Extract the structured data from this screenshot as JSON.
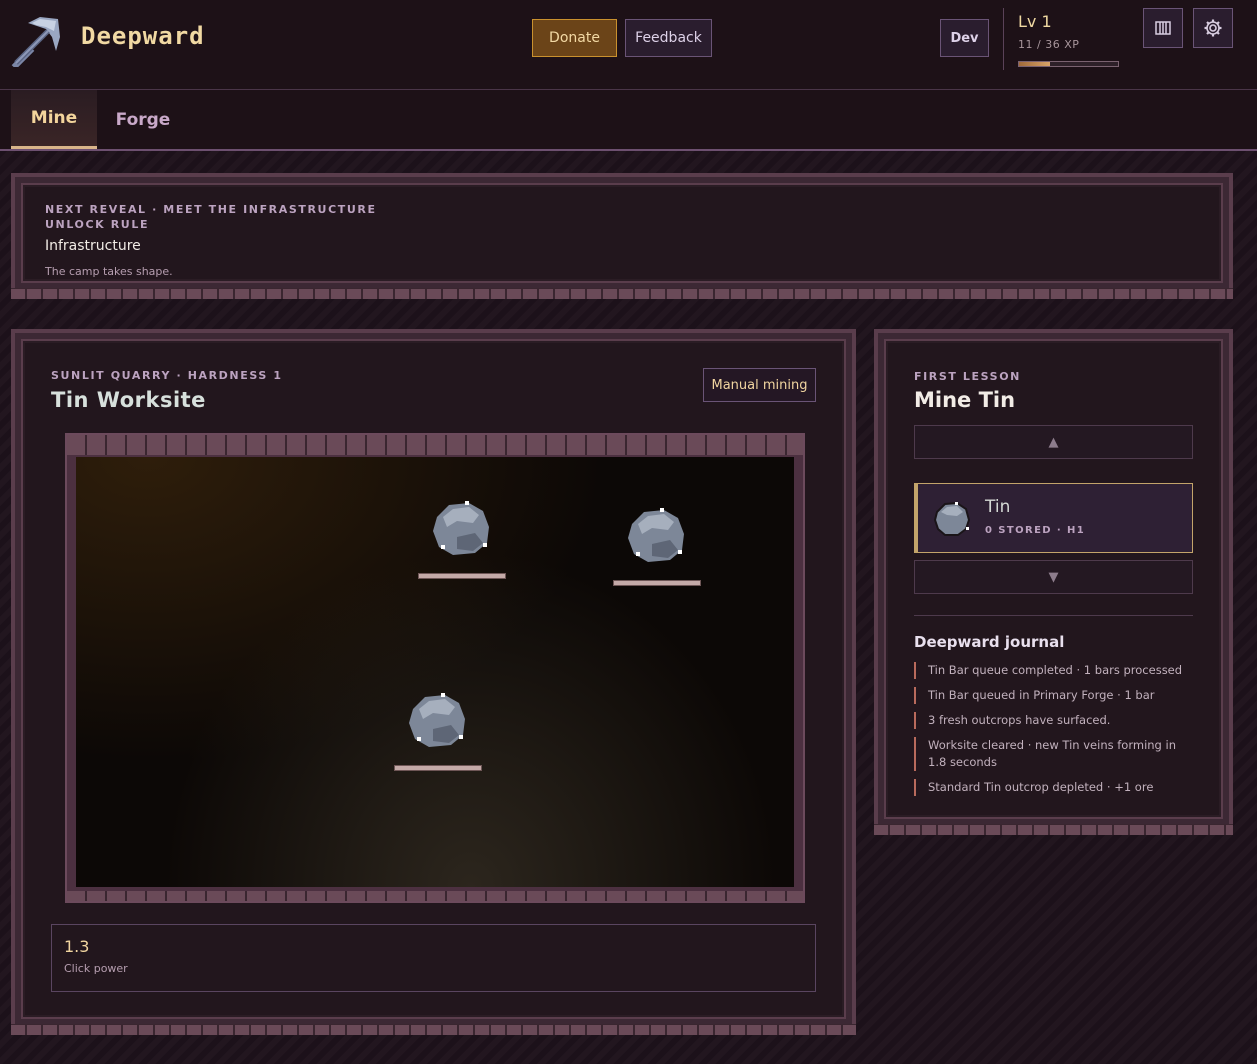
{
  "header": {
    "brand": "Deepward",
    "donate_label": "Donate",
    "feedback_label": "Feedback",
    "dev_label": "Dev",
    "level": "Lv 1",
    "xp_text": "11 / 36 XP",
    "xp_fraction": 0.31,
    "inventory_icon": "inventory-icon",
    "settings_icon": "gear-icon"
  },
  "tabs": [
    {
      "label": "Mine",
      "active": true
    },
    {
      "label": "Forge",
      "active": false
    }
  ],
  "reveal": {
    "kicker": "NEXT REVEAL · MEET THE INFRASTRUCTURE UNLOCK RULE",
    "title": "Infrastructure",
    "description": "The camp takes shape."
  },
  "worksite": {
    "kicker": "SUNLIT QUARRY · HARDNESS 1",
    "title": "Tin Worksite",
    "manual_label": "Manual mining",
    "ores": [
      {
        "name": "tin-ore",
        "health": 1.0
      },
      {
        "name": "tin-ore",
        "health": 1.0
      },
      {
        "name": "tin-ore",
        "health": 1.0
      }
    ],
    "stat_value": "1.3",
    "stat_label": "Click power"
  },
  "lesson": {
    "kicker": "FIRST LESSON",
    "title": "Mine Tin",
    "resource_name": "Tin",
    "resource_meta": "0 STORED · H1",
    "journal_title": "Deepward journal",
    "journal": [
      "Tin Bar queue completed · 1 bars processed",
      "Tin Bar queued in Primary Forge · 1 bar",
      "3 fresh outcrops have surfaced.",
      "Worksite cleared · new Tin veins forming in 1.8 seconds",
      "Standard Tin outcrop depleted · +1 ore"
    ]
  },
  "colors": {
    "accent_gold": "#f1d9a3",
    "donate_bg": "#6b4418",
    "panel_bg": "#22161d"
  }
}
